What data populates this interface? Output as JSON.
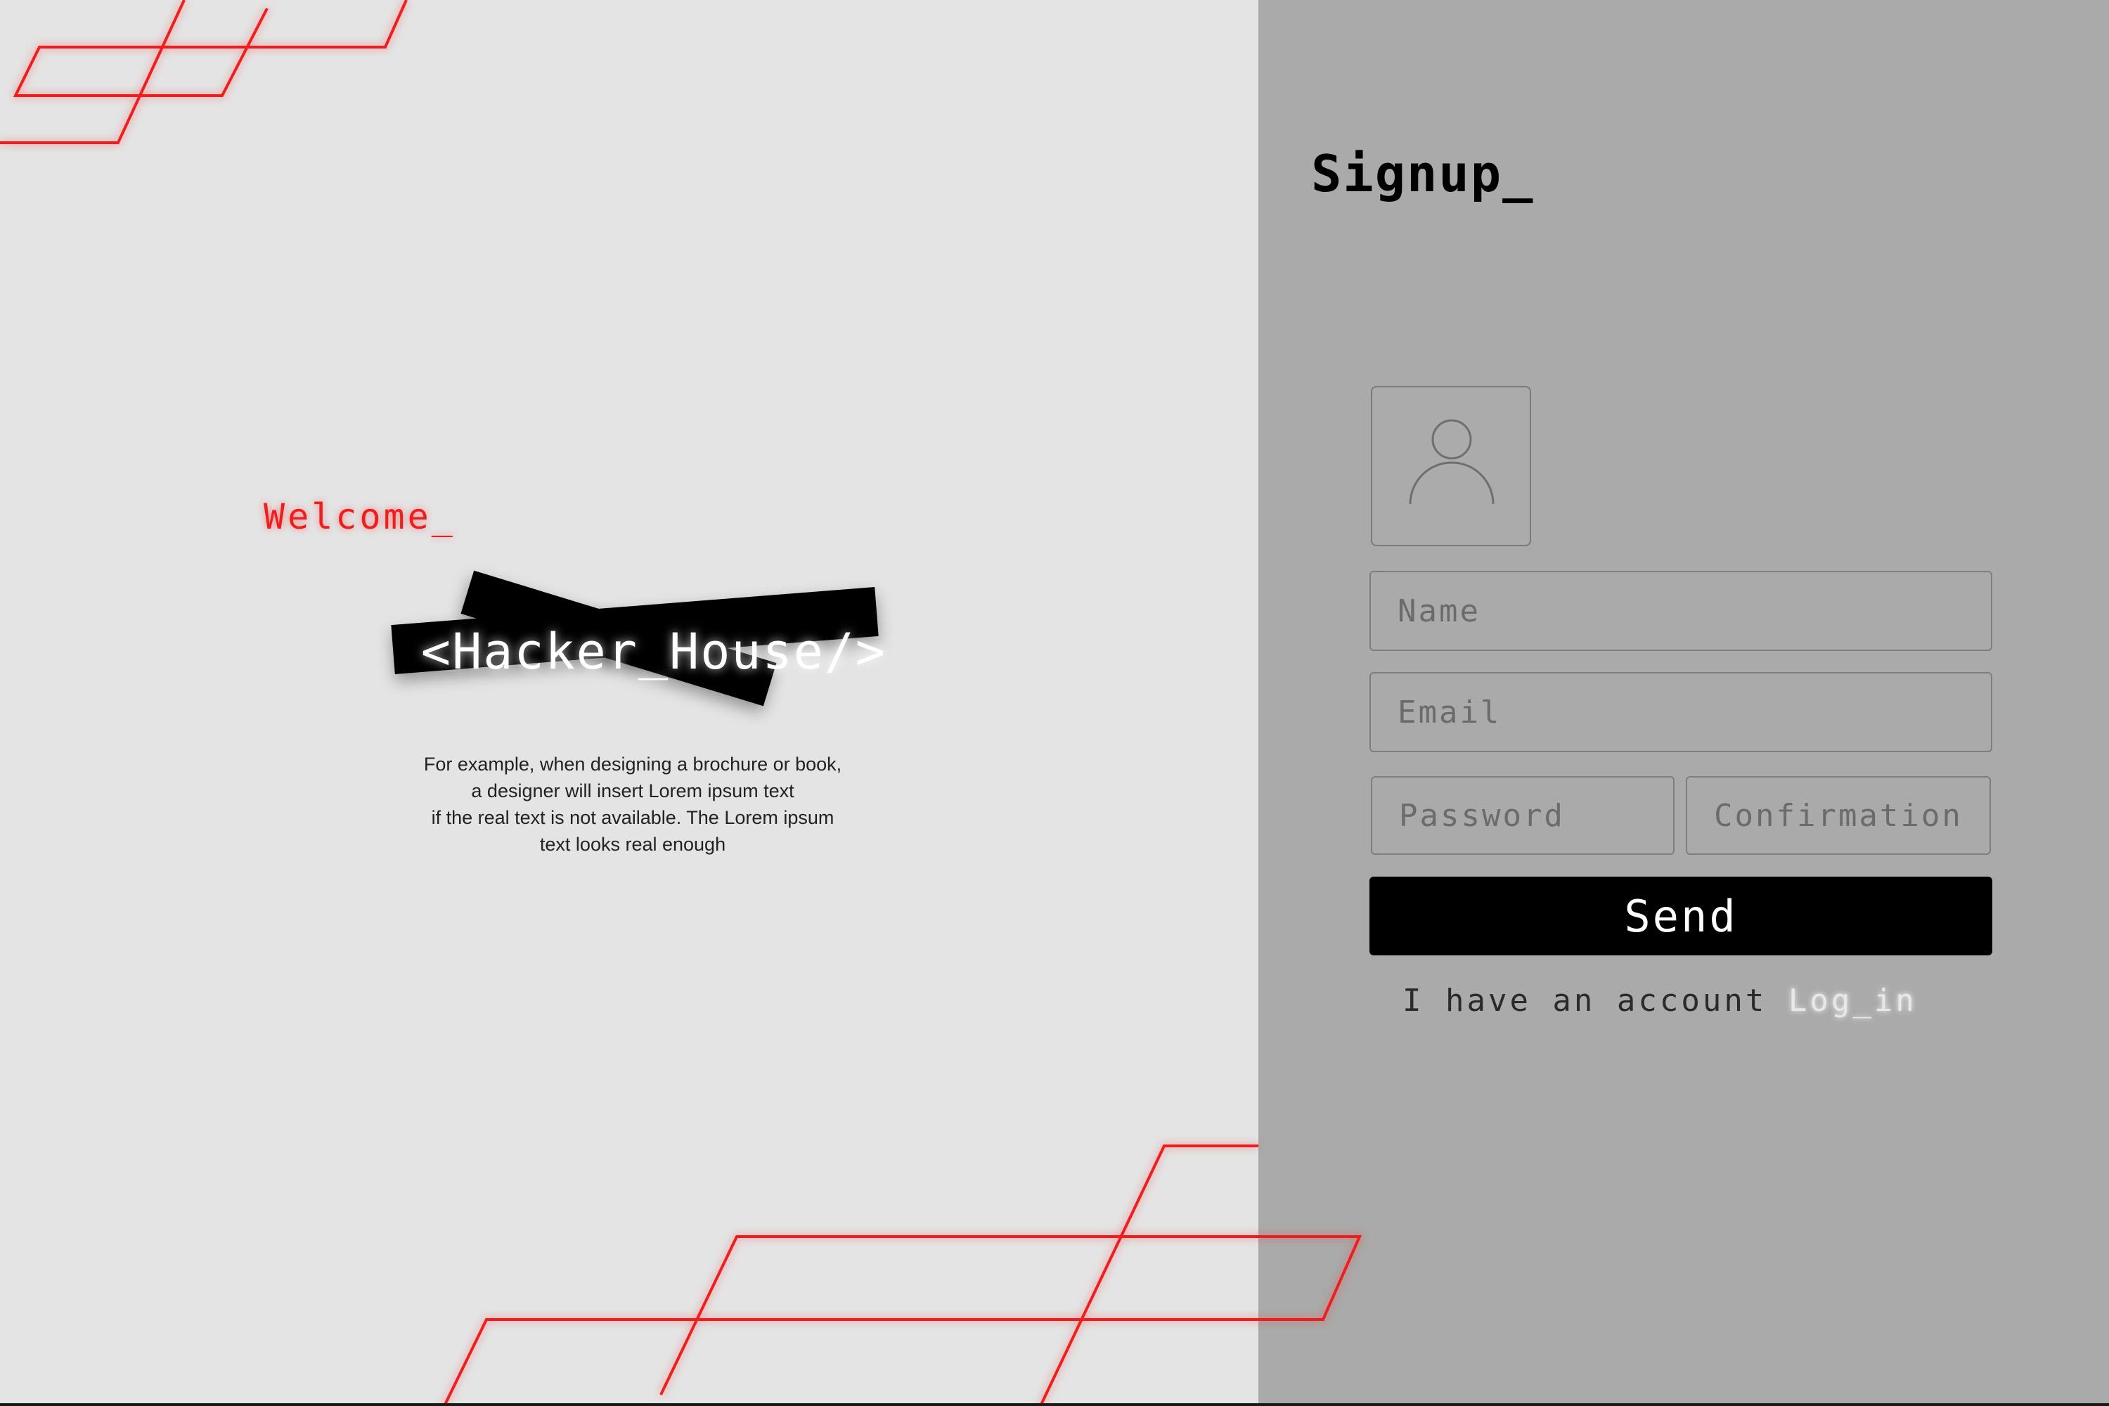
{
  "colors": {
    "left_background": "#e4e4e4",
    "right_background": "#aaaaaa",
    "accent_red": "#ee1e1e",
    "button_black": "#000000"
  },
  "welcome": {
    "text": "Welcome_"
  },
  "logo": {
    "text": "<Hacker_House/>"
  },
  "description": {
    "lines": [
      "For example, when designing a brochure or book,",
      "a designer will insert Lorem ipsum text",
      "if the real text is not available. The Lorem ipsum",
      "text looks real enough"
    ]
  },
  "signup": {
    "title": "Signup_",
    "avatar_icon": "user-avatar-icon",
    "name_placeholder": "Name",
    "email_placeholder": "Email",
    "password_placeholder": "Password",
    "confirmation_placeholder": "Confirmation",
    "send_label": "Send",
    "account_text": "I have an account",
    "login_label": "Log_in"
  }
}
